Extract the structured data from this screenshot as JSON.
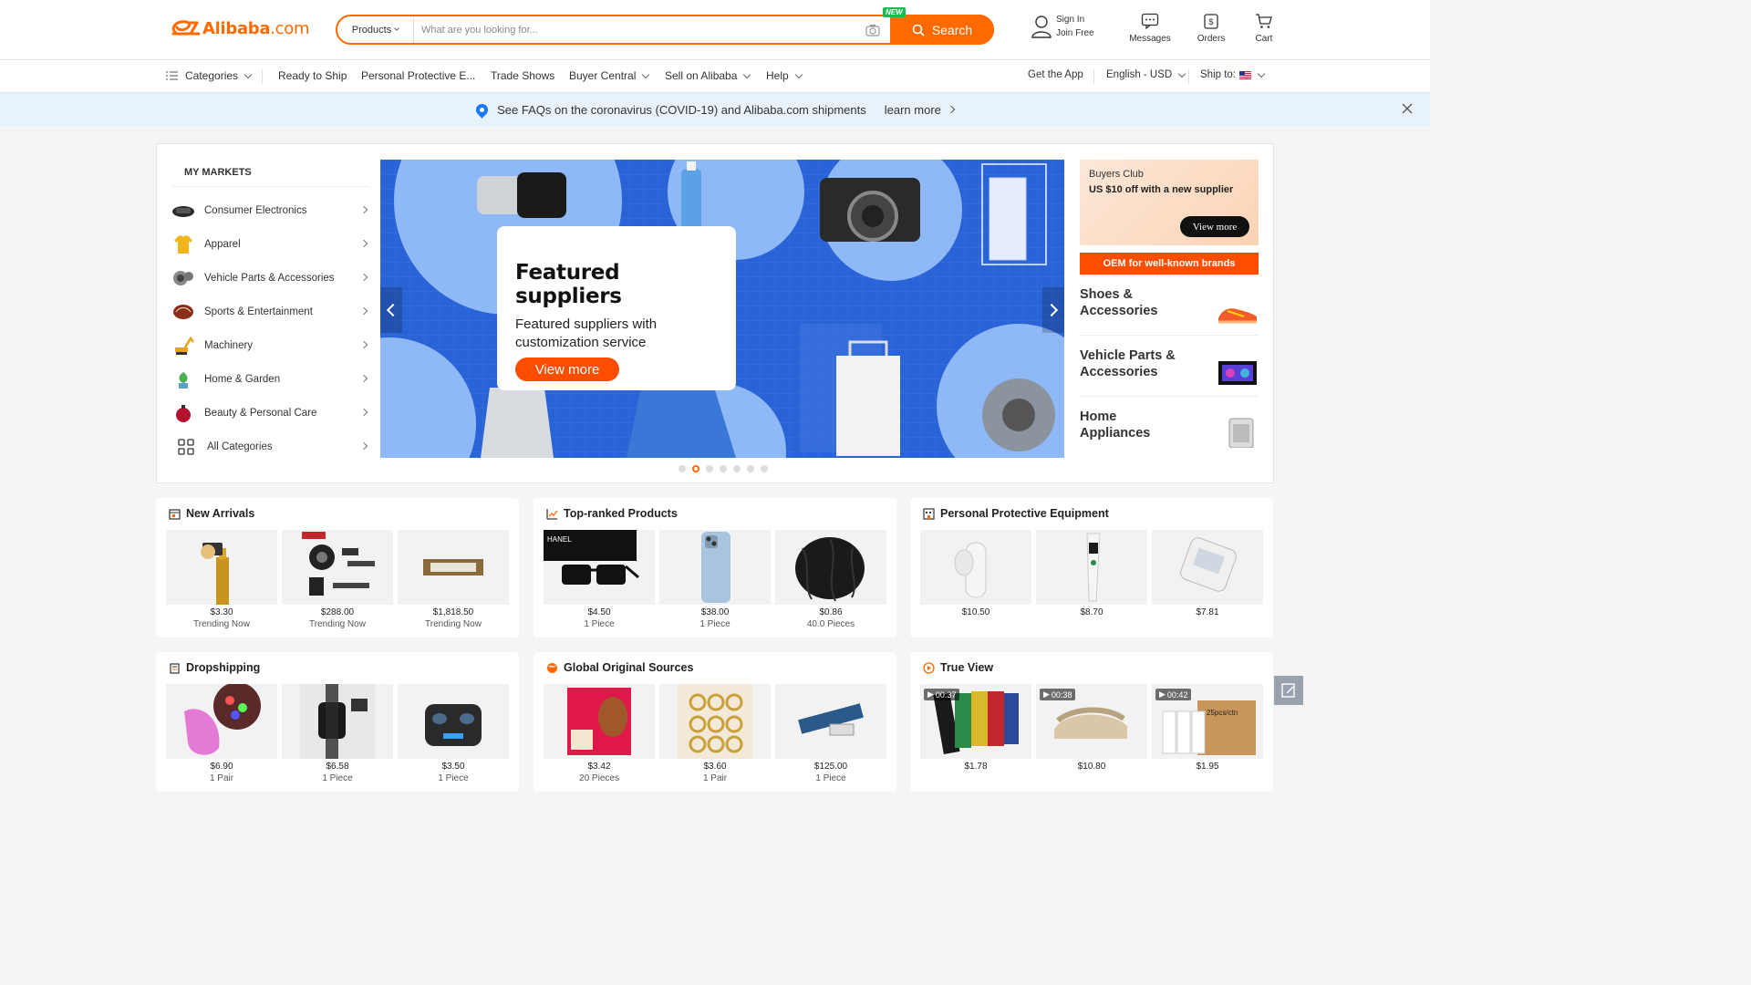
{
  "header": {
    "logo_text": "Alibaba",
    "logo_suffix": ".com",
    "search": {
      "category": "Products",
      "placeholder": "What are you looking for...",
      "button_label": "Search",
      "new_badge": "NEW"
    },
    "actions": {
      "sign_in": "Sign In",
      "join_free": "Join Free",
      "messages": "Messages",
      "orders": "Orders",
      "cart": "Cart"
    }
  },
  "nav": {
    "categories": "Categories",
    "ready_to_ship": "Ready to Ship",
    "ppe": "Personal Protective E...",
    "trade_shows": "Trade Shows",
    "buyer_central": "Buyer Central",
    "sell_on_alibaba": "Sell on Alibaba",
    "help": "Help",
    "get_the_app": "Get the App",
    "language_currency": "English - USD",
    "ship_to": "Ship to:"
  },
  "notice": {
    "text": "See FAQs on the coronavirus (COVID-19) and Alibaba.com shipments",
    "link": "learn more"
  },
  "markets": {
    "title": "MY MARKETS",
    "items": [
      {
        "label": "Consumer Electronics",
        "icon": "headset-icon"
      },
      {
        "label": "Apparel",
        "icon": "tshirt-icon"
      },
      {
        "label": "Vehicle Parts & Accessories",
        "icon": "engine-icon"
      },
      {
        "label": "Sports & Entertainment",
        "icon": "ball-icon"
      },
      {
        "label": "Machinery",
        "icon": "excavator-icon"
      },
      {
        "label": "Home & Garden",
        "icon": "plant-icon"
      },
      {
        "label": "Beauty & Personal Care",
        "icon": "perfume-icon"
      },
      {
        "label": "All Categories",
        "icon": "grid-icon"
      }
    ]
  },
  "banner": {
    "title": "Featured suppliers",
    "subtitle": "Featured suppliers with customization service",
    "button": "View more",
    "dot_count": 7,
    "active_dot": 1
  },
  "right_column": {
    "buyers_club_title": "Buyers Club",
    "buyers_club_offer": "US $10 off with a new supplier",
    "buyers_club_button": "View more",
    "oem_label": "OEM for well-known brands",
    "categories": [
      {
        "label": "Shoes & Accessories"
      },
      {
        "label": "Vehicle Parts & Accessories"
      },
      {
        "label": "Home Appliances"
      }
    ]
  },
  "cards": [
    {
      "title": "New Arrivals",
      "products": [
        {
          "price": "$3.30",
          "unit": "Trending Now"
        },
        {
          "price": "$288.00",
          "unit": "Trending Now"
        },
        {
          "price": "$1,818.50",
          "unit": "Trending Now"
        }
      ]
    },
    {
      "title": "Top-ranked Products",
      "products": [
        {
          "price": "$4.50",
          "unit": "1 Piece",
          "overlay": "HANEL"
        },
        {
          "price": "$38.00",
          "unit": "1 Piece"
        },
        {
          "price": "$0.86",
          "unit": "40.0 Pieces"
        }
      ]
    },
    {
      "title": "Personal Protective Equipment",
      "products": [
        {
          "price": "$10.50",
          "unit": ""
        },
        {
          "price": "$8.70",
          "unit": ""
        },
        {
          "price": "$7.81",
          "unit": ""
        }
      ]
    },
    {
      "title": "Dropshipping",
      "products": [
        {
          "price": "$6.90",
          "unit": "1 Pair"
        },
        {
          "price": "$6.58",
          "unit": "1 Piece"
        },
        {
          "price": "$3.50",
          "unit": "1 Piece"
        }
      ]
    },
    {
      "title": "Global Original Sources",
      "products": [
        {
          "price": "$3.42",
          "unit": "20 Pieces"
        },
        {
          "price": "$3.60",
          "unit": "1 Pair"
        },
        {
          "price": "$125.00",
          "unit": "1 Piece"
        }
      ]
    },
    {
      "title": "True View",
      "products": [
        {
          "price": "$1.78",
          "unit": "",
          "video": "00:37"
        },
        {
          "price": "$10.80",
          "unit": "",
          "video": "00:38"
        },
        {
          "price": "$1.95",
          "unit": "",
          "video": "00:42",
          "overlay": "25pcs/ctn"
        }
      ]
    }
  ],
  "colors": {
    "brand": "#ff6a00",
    "banner_blue": "#2a63d6",
    "notice_bg": "#e8f2fb"
  }
}
